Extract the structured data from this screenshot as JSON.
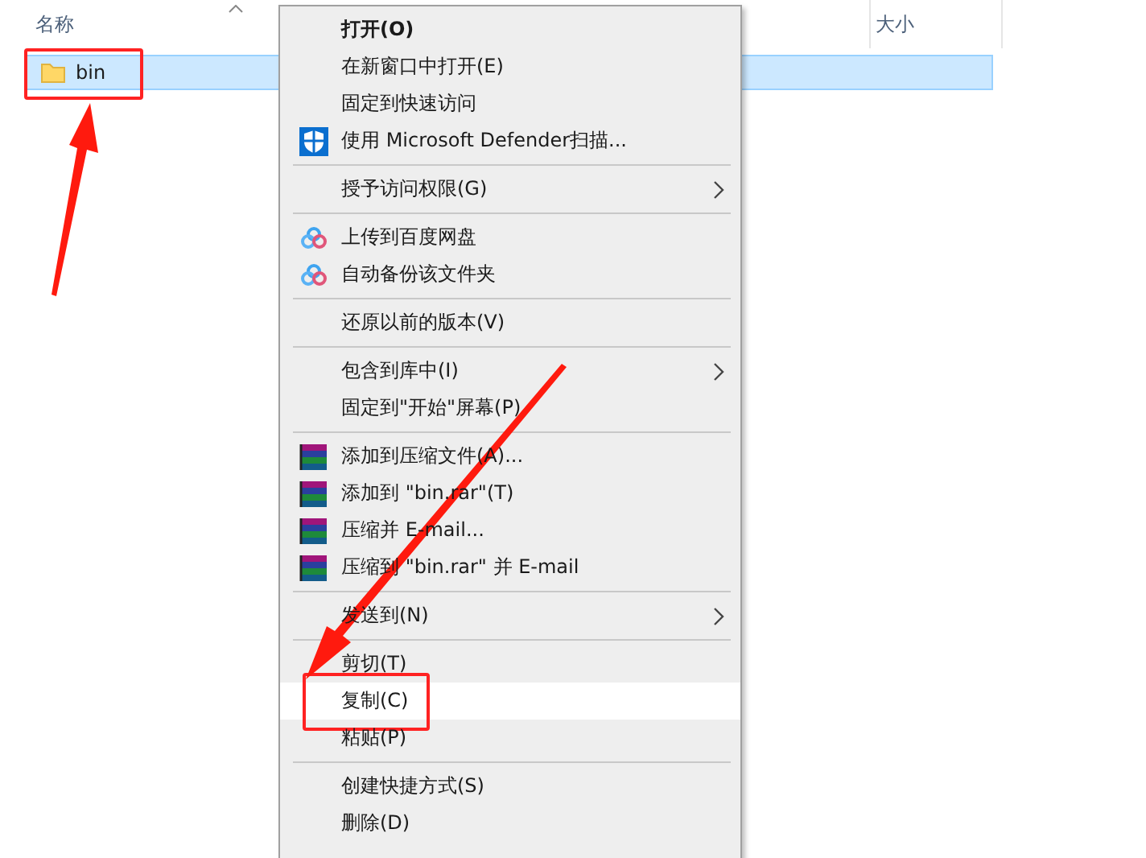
{
  "columns": [
    {
      "label": "名称",
      "sorted": true
    },
    {
      "label": "大小",
      "sorted": false
    }
  ],
  "file": {
    "name": "bin",
    "selected": true
  },
  "menu": [
    {
      "kind": "plain",
      "label": "打开(O)",
      "default": true,
      "submenu": false,
      "selected": false
    },
    {
      "kind": "plain",
      "label": "在新窗口中打开(E)",
      "default": false,
      "submenu": false,
      "selected": false
    },
    {
      "kind": "plain",
      "label": "固定到快速访问",
      "default": false,
      "submenu": false,
      "selected": false
    },
    {
      "kind": "defender",
      "label": "使用 Microsoft Defender扫描...",
      "default": false,
      "submenu": false,
      "selected": false
    },
    {
      "kind": "separator"
    },
    {
      "kind": "plain",
      "label": "授予访问权限(G)",
      "default": false,
      "submenu": true,
      "selected": false
    },
    {
      "kind": "separator"
    },
    {
      "kind": "cloud",
      "label": "上传到百度网盘",
      "default": false,
      "submenu": false,
      "selected": false
    },
    {
      "kind": "cloud",
      "label": "自动备份该文件夹",
      "default": false,
      "submenu": false,
      "selected": false
    },
    {
      "kind": "separator"
    },
    {
      "kind": "plain",
      "label": "还原以前的版本(V)",
      "default": false,
      "submenu": false,
      "selected": false
    },
    {
      "kind": "separator"
    },
    {
      "kind": "plain",
      "label": "包含到库中(I)",
      "default": false,
      "submenu": true,
      "selected": false
    },
    {
      "kind": "plain",
      "label": "固定到\"开始\"屏幕(P)",
      "default": false,
      "submenu": false,
      "selected": false
    },
    {
      "kind": "separator"
    },
    {
      "kind": "archive",
      "label": "添加到压缩文件(A)...",
      "default": false,
      "submenu": false,
      "selected": false
    },
    {
      "kind": "archive",
      "label": "添加到 \"bin.rar\"(T)",
      "default": false,
      "submenu": false,
      "selected": false
    },
    {
      "kind": "archive",
      "label": "压缩并 E-mail...",
      "default": false,
      "submenu": false,
      "selected": false
    },
    {
      "kind": "archive",
      "label": "压缩到 \"bin.rar\" 并 E-mail",
      "default": false,
      "submenu": false,
      "selected": false
    },
    {
      "kind": "separator"
    },
    {
      "kind": "plain",
      "label": "发送到(N)",
      "default": false,
      "submenu": true,
      "selected": false
    },
    {
      "kind": "separator"
    },
    {
      "kind": "plain",
      "label": "剪切(T)",
      "default": false,
      "submenu": false,
      "selected": false
    },
    {
      "kind": "plain",
      "label": "复制(C)",
      "default": false,
      "submenu": false,
      "selected": true
    },
    {
      "kind": "plain",
      "label": "粘贴(P)",
      "default": false,
      "submenu": false,
      "selected": false
    },
    {
      "kind": "separator"
    },
    {
      "kind": "plain",
      "label": "创建快捷方式(S)",
      "default": false,
      "submenu": false,
      "selected": false
    },
    {
      "kind": "plain",
      "label": "删除(D)",
      "default": false,
      "submenu": false,
      "selected": false
    }
  ]
}
